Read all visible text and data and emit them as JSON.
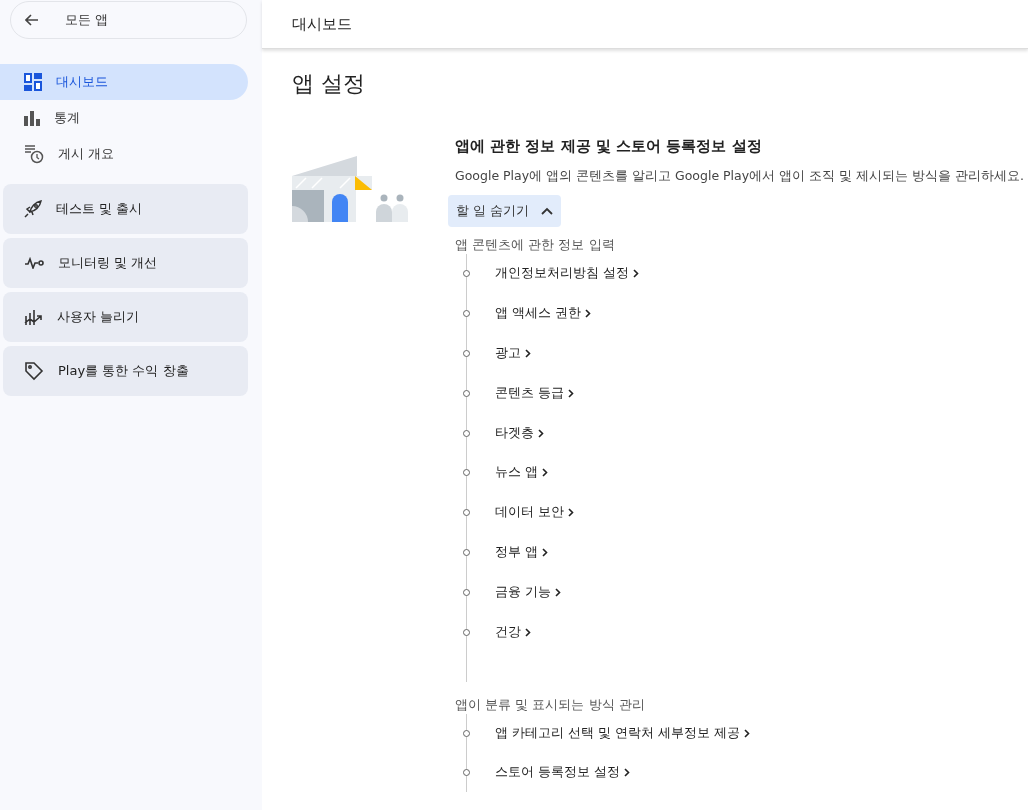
{
  "sidebar": {
    "back_button": {
      "label": "모든 앱"
    },
    "items": [
      {
        "kind": "dashboard",
        "label": "대시보드",
        "selected": true
      },
      {
        "kind": "stats",
        "label": "통계",
        "selected": false
      },
      {
        "kind": "publishing",
        "label": "게시 개요",
        "selected": false
      }
    ],
    "groups": [
      {
        "kind": "rocket",
        "label": "테스트 및 출시"
      },
      {
        "kind": "pulse",
        "label": "모니터링 및 개선"
      },
      {
        "kind": "growth",
        "label": "사용자 늘리기"
      },
      {
        "kind": "tag",
        "label": "Play를 통한 수익 창출"
      }
    ]
  },
  "header": {
    "title": "대시보드"
  },
  "page_title": "앱 설정",
  "setup_card": {
    "title": "앱에 관한 정보 제공 및 스토어 등록정보 설정",
    "description": "Google Play에 앱의 콘텐츠를 알리고 Google Play에서 앱이 조직 및 제시되는 방식을 관리하세요.",
    "toggle_button": {
      "label": "할 일 숨기기",
      "expanded": true
    },
    "sections": [
      {
        "heading": "앱 콘텐츠에 관한 정보 입력",
        "tasks": [
          "개인정보처리방침 설정",
          "앱 액세스 권한",
          "광고",
          "콘텐츠 등급",
          "타겟층",
          "뉴스 앱",
          "데이터 보안",
          "정부 앱",
          "금융 기능",
          "건강"
        ]
      },
      {
        "heading": "앱이 분류 및 표시되는 방식 관리",
        "tasks": [
          "앱 카테고리 선택 및 연락처 세부정보 제공",
          "스토어 등록정보 설정"
        ]
      }
    ]
  }
}
